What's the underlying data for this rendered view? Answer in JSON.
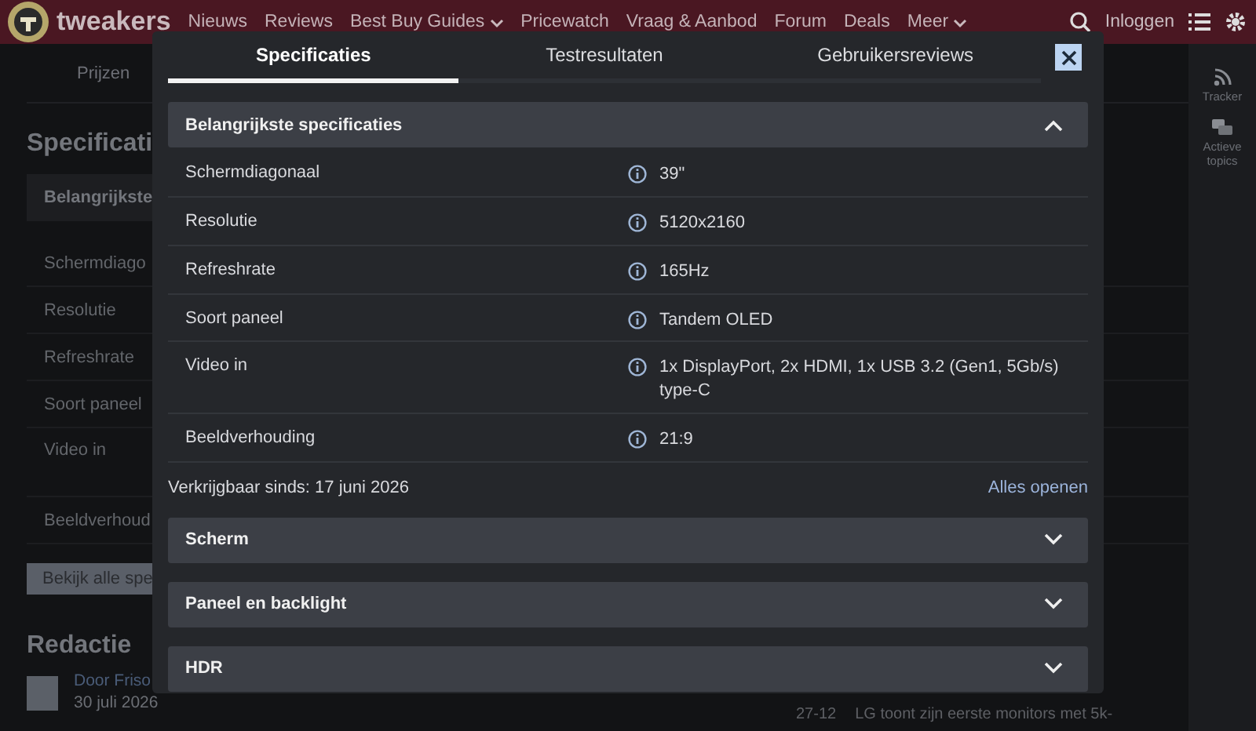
{
  "header": {
    "logo_text": "tweakers",
    "nav": [
      {
        "label": "Nieuws",
        "dropdown": false
      },
      {
        "label": "Reviews",
        "dropdown": false
      },
      {
        "label": "Best Buy Guides",
        "dropdown": true
      },
      {
        "label": "Pricewatch",
        "dropdown": false
      },
      {
        "label": "Vraag & Aanbod",
        "dropdown": false
      },
      {
        "label": "Forum",
        "dropdown": false
      },
      {
        "label": "Deals",
        "dropdown": false
      },
      {
        "label": "Meer",
        "dropdown": true
      }
    ],
    "login": "Inloggen"
  },
  "page": {
    "tab": "Prijzen",
    "section_title": "Specificati",
    "group": "Belangrijkste",
    "rows": [
      {
        "label": "Schermdiago",
        "tall": false
      },
      {
        "label": "Resolutie",
        "tall": false
      },
      {
        "label": "Refreshrate",
        "tall": false
      },
      {
        "label": "Soort paneel",
        "tall": false
      },
      {
        "label": "Video in",
        "tall": true
      },
      {
        "label": "Beeldverhoud",
        "tall": false
      }
    ],
    "button": "Bekijk alle spe",
    "editorial_title": "Redactie",
    "author": "Door Friso",
    "date": "30 juli 2026",
    "news": {
      "date": "27-12",
      "title": "LG toont zijn eerste monitors met 5k-"
    }
  },
  "sidebar": [
    {
      "label": "Tracker",
      "kind": "rss"
    },
    {
      "label": "Actieve topics",
      "kind": "chat"
    }
  ],
  "modal": {
    "tabs": [
      {
        "label": "Specificaties",
        "selected": true
      },
      {
        "label": "Testresultaten",
        "selected": false
      },
      {
        "label": "Gebruikersreviews",
        "selected": false
      }
    ],
    "sections": [
      {
        "title": "Belangrijkste specificaties",
        "expanded": true,
        "rows": [
          {
            "label": "Schermdiagonaal",
            "value": "39\""
          },
          {
            "label": "Resolutie",
            "value": "5120x2160"
          },
          {
            "label": "Refreshrate",
            "value": "165Hz"
          },
          {
            "label": "Soort paneel",
            "value": "Tandem OLED"
          },
          {
            "label": "Video in",
            "value": "1x DisplayPort, 2x HDMI, 1x USB 3.2 (Gen1, 5Gb/s) type-C"
          },
          {
            "label": "Beeldverhouding",
            "value": "21:9"
          }
        ]
      },
      {
        "title": "Scherm",
        "expanded": false
      },
      {
        "title": "Paneel en backlight",
        "expanded": false
      },
      {
        "title": "HDR",
        "expanded": false
      }
    ],
    "available": "Verkrijgbaar sinds: 17 juni 2026",
    "open_all": "Alles openen"
  }
}
